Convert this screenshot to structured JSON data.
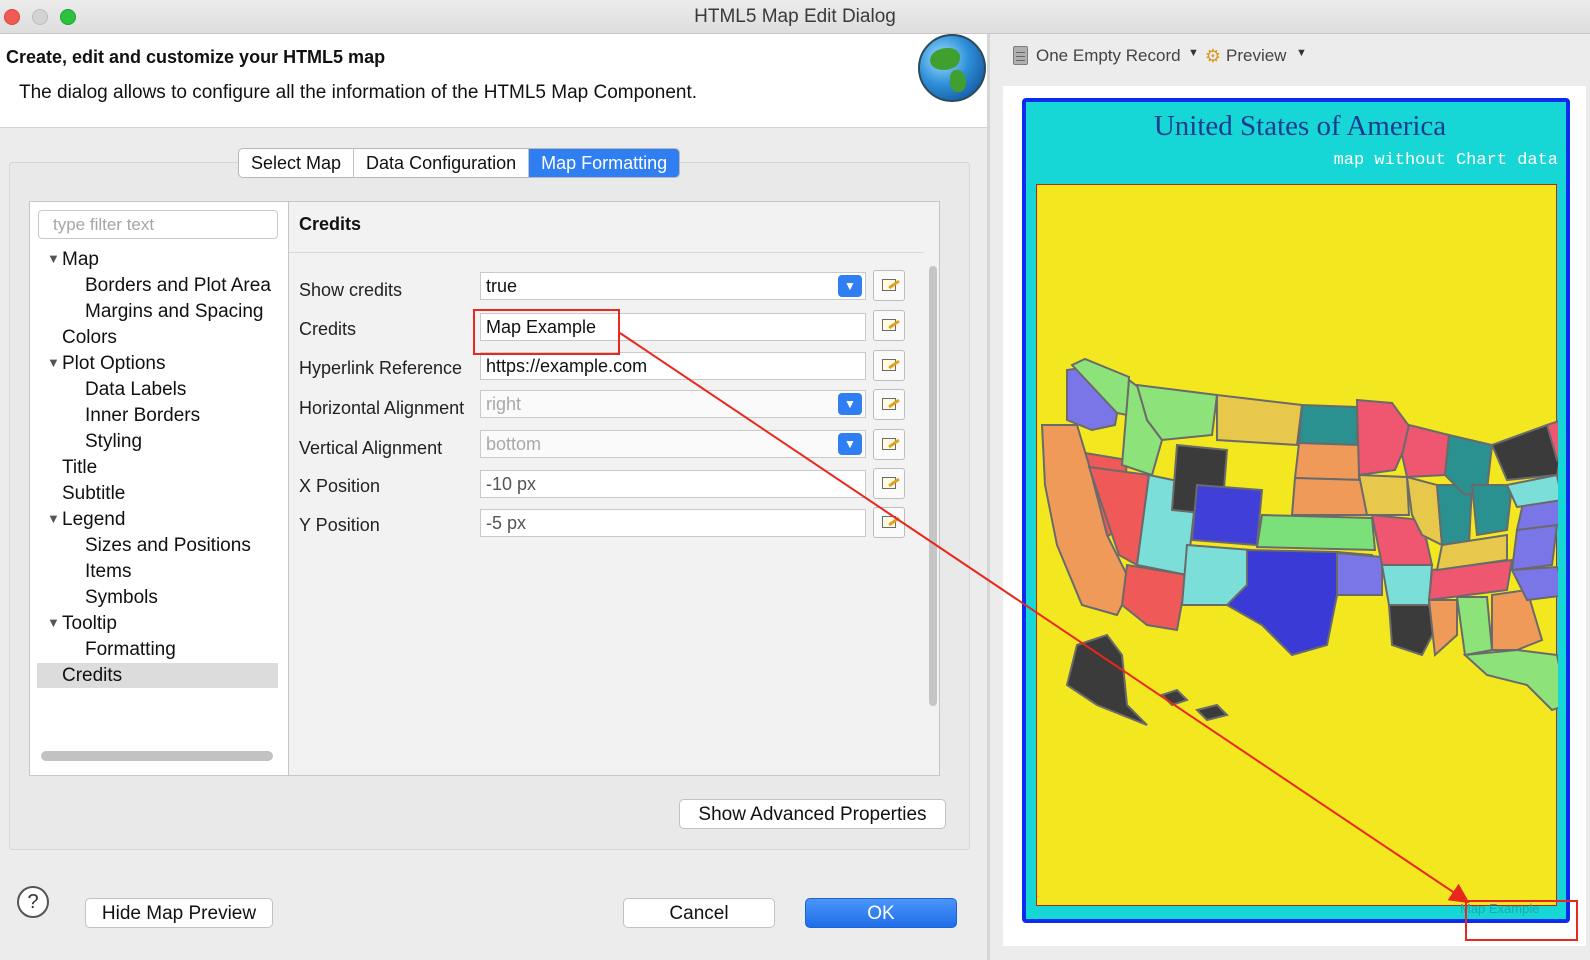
{
  "window": {
    "title": "HTML5 Map Edit Dialog"
  },
  "header": {
    "title": "Create, edit and customize your HTML5 map",
    "description": "The dialog allows to configure all the information of the HTML5 Map Component."
  },
  "tabs": [
    {
      "label": "Select Map",
      "active": false
    },
    {
      "label": "Data Configuration",
      "active": false
    },
    {
      "label": "Map Formatting",
      "active": true
    }
  ],
  "tree": {
    "filter_placeholder": "type filter text",
    "items": [
      {
        "label": "Map",
        "level": 0,
        "expanded": true
      },
      {
        "label": "Borders and Plot Area",
        "level": 1
      },
      {
        "label": "Margins and Spacing",
        "level": 1
      },
      {
        "label": "Colors",
        "level": 0
      },
      {
        "label": "Plot Options",
        "level": 0,
        "expanded": true
      },
      {
        "label": "Data Labels",
        "level": 1
      },
      {
        "label": "Inner Borders",
        "level": 1
      },
      {
        "label": "Styling",
        "level": 1
      },
      {
        "label": "Title",
        "level": 0
      },
      {
        "label": "Subtitle",
        "level": 0
      },
      {
        "label": "Legend",
        "level": 0,
        "expanded": true
      },
      {
        "label": "Sizes and Positions",
        "level": 1
      },
      {
        "label": "Items",
        "level": 1
      },
      {
        "label": "Symbols",
        "level": 1
      },
      {
        "label": "Tooltip",
        "level": 0,
        "expanded": true
      },
      {
        "label": "Formatting",
        "level": 1
      },
      {
        "label": "Credits",
        "level": 0,
        "selected": true
      }
    ]
  },
  "properties": {
    "section_title": "Credits",
    "rows": [
      {
        "label": "Show credits",
        "value": "true",
        "type": "dropdown",
        "disabled": false
      },
      {
        "label": "Credits",
        "value": "Map Example",
        "type": "text",
        "disabled": false
      },
      {
        "label": "Hyperlink Reference",
        "value": "https://example.com",
        "type": "text",
        "disabled": false
      },
      {
        "label": "Horizontal Alignment",
        "value": "right",
        "type": "dropdown",
        "disabled": true
      },
      {
        "label": "Vertical Alignment",
        "value": "bottom",
        "type": "dropdown",
        "disabled": true
      },
      {
        "label": "X Position",
        "value": "-10 px",
        "type": "text",
        "disabled": true
      },
      {
        "label": "Y Position",
        "value": "-5 px",
        "type": "text",
        "disabled": true
      }
    ]
  },
  "buttons": {
    "advanced": "Show Advanced Properties",
    "hide_preview": "Hide Map Preview",
    "cancel": "Cancel",
    "ok": "OK",
    "help": "?"
  },
  "preview": {
    "record_label": "One Empty Record",
    "preview_label": "Preview",
    "map_title": "United States of America",
    "map_subtitle": "map without Chart data",
    "credits_text": "Map Example",
    "colors": {
      "background": "#17d7d6",
      "border": "#0a2cf0",
      "plot_area": "#f3e81f",
      "title": "#1b3c8f"
    }
  },
  "colors": {
    "accent": "#2f7ef2",
    "annotation": "#e8281c"
  }
}
